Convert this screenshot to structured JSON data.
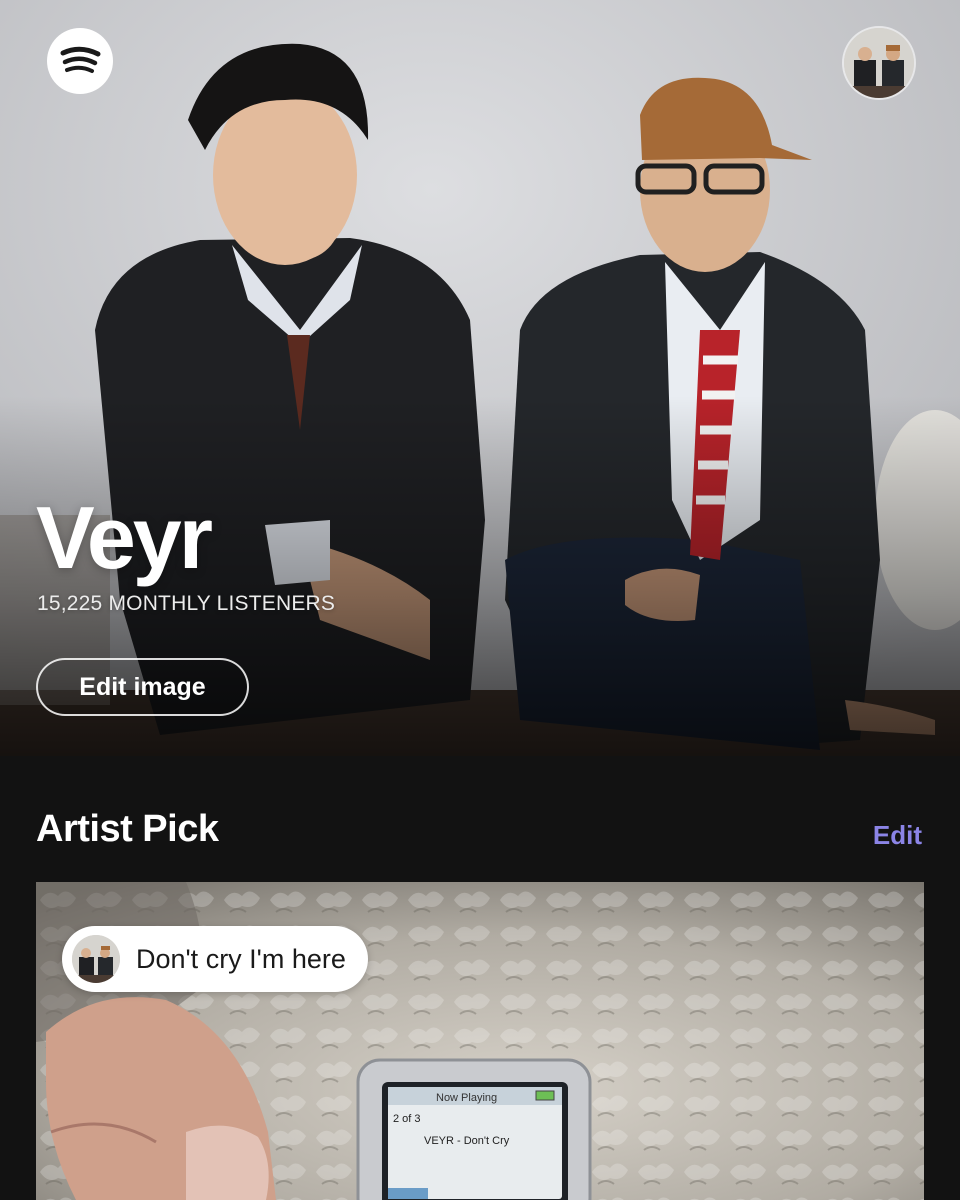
{
  "header": {
    "logo_icon": "spotify-logo-icon",
    "profile_icon": "profile-avatar"
  },
  "artist": {
    "name": "Veyr",
    "monthly_listeners": "15,225 MONTHLY LISTENERS",
    "edit_image_label": "Edit image"
  },
  "artist_pick": {
    "title": "Artist Pick",
    "edit_label": "Edit",
    "pick_title": "Don't cry I'm here",
    "device_screen": {
      "header": "Now Playing",
      "position": "2 of 3",
      "track": "VEYR - Don't Cry"
    }
  },
  "colors": {
    "background": "#121212",
    "accent_link": "#8b84e6",
    "text": "#ffffff"
  }
}
